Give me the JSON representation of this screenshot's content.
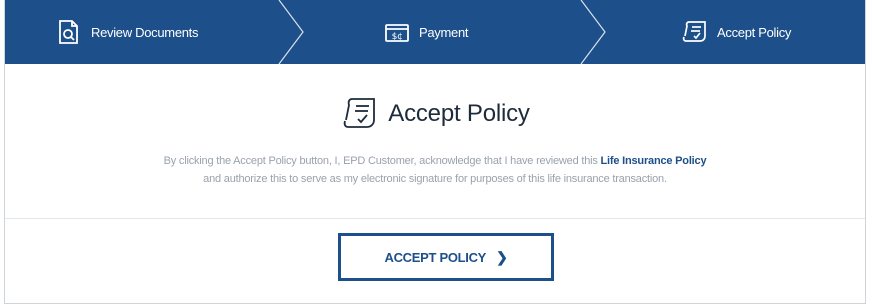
{
  "steps": [
    {
      "label": "Review Documents",
      "icon": "document-search-icon"
    },
    {
      "label": "Payment",
      "icon": "payment-icon"
    },
    {
      "label": "Accept Policy",
      "icon": "policy-scroll-icon"
    }
  ],
  "main": {
    "title": "Accept Policy",
    "desc_part1": "By clicking the Accept Policy button, I, EPD Customer, acknowledge that I have reviewed this ",
    "desc_link": "Life Insurance Policy",
    "desc_part2": " and authorize this to serve as my electronic signature for purposes of this life insurance transaction.",
    "button_label": "ACCEPT POLICY",
    "button_arrow": "❯"
  },
  "colors": {
    "primary": "#1d4f8a",
    "text_muted": "#9aa2ab",
    "title": "#1e2b3a"
  }
}
